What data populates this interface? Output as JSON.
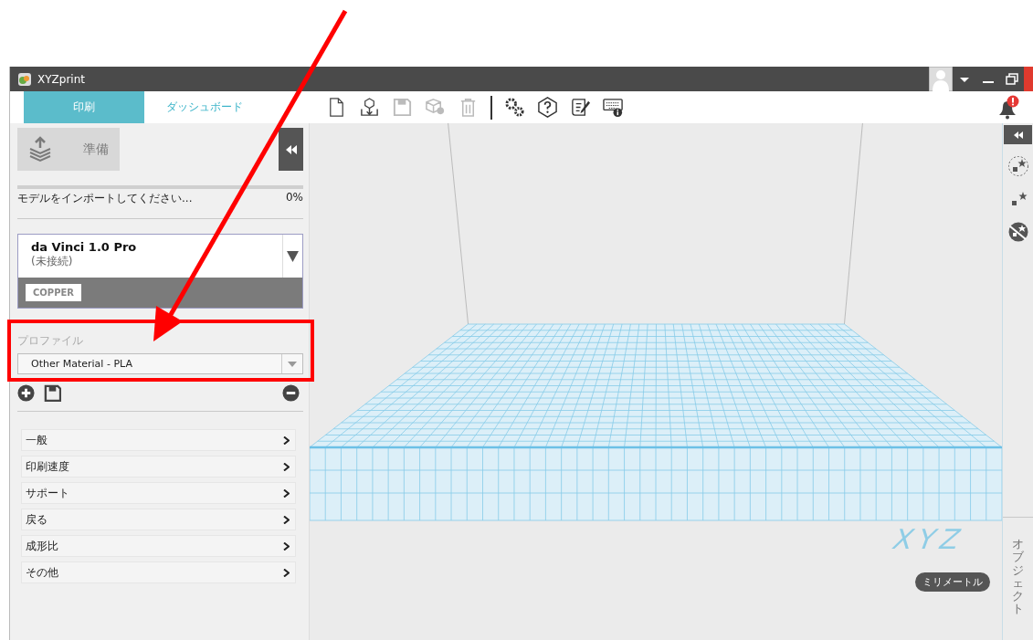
{
  "window": {
    "title": "XYZprint"
  },
  "tabs": [
    {
      "label": "印刷",
      "selected": true
    },
    {
      "label": "ダッシュボード",
      "selected": false
    }
  ],
  "prepare_button": {
    "label": "準備",
    "disabled": true
  },
  "import_progress": {
    "message": "モデルをインポートしてください...",
    "percent": "0%",
    "level": 0
  },
  "printer": {
    "name": "da Vinci 1.0 Pro",
    "status": "(未接続)",
    "material": "COPPER"
  },
  "profile": {
    "label": "プロファイル",
    "value": "Other Material - PLA"
  },
  "settings": [
    {
      "label": "一般"
    },
    {
      "label": "印刷速度"
    },
    {
      "label": "サポート"
    },
    {
      "label": "戻る"
    },
    {
      "label": "成形比"
    },
    {
      "label": "その他"
    }
  ],
  "viewport": {
    "bed_logo": "XYZ",
    "units": "ミリメートル"
  },
  "right_panel": {
    "tab": "オブジェクト"
  }
}
